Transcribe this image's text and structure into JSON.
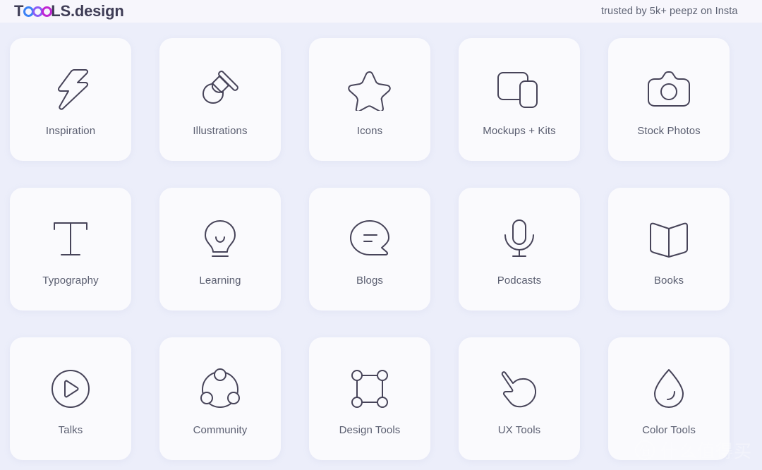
{
  "header": {
    "logo": {
      "prefix": "T",
      "suffix": "LS.design",
      "ring_colors": [
        "#3b82f6",
        "#8b5cf6",
        "#c026d3"
      ]
    },
    "tagline": "trusted by 5k+ peepz on Insta"
  },
  "theme": {
    "page_background": "#eceefa",
    "header_background": "#f7f6fc",
    "card_background": "#fafafd",
    "icon_stroke": "#474459",
    "label_color": "#5a5e70"
  },
  "grid": {
    "cards": [
      {
        "label": "Inspiration",
        "icon": "lightning-bolt-icon"
      },
      {
        "label": "Illustrations",
        "icon": "paintbrush-icon"
      },
      {
        "label": "Icons",
        "icon": "star-icon"
      },
      {
        "label": "Mockups + Kits",
        "icon": "devices-icon"
      },
      {
        "label": "Stock Photos",
        "icon": "camera-icon"
      },
      {
        "label": "Typography",
        "icon": "letter-t-icon"
      },
      {
        "label": "Learning",
        "icon": "lightbulb-icon"
      },
      {
        "label": "Blogs",
        "icon": "speech-bubble-icon"
      },
      {
        "label": "Podcasts",
        "icon": "microphone-icon"
      },
      {
        "label": "Books",
        "icon": "open-book-icon"
      },
      {
        "label": "Talks",
        "icon": "play-circle-icon"
      },
      {
        "label": "Community",
        "icon": "share-nodes-icon"
      },
      {
        "label": "Design Tools",
        "icon": "square-handles-icon"
      },
      {
        "label": "UX Tools",
        "icon": "cursor-hand-icon"
      },
      {
        "label": "Color Tools",
        "icon": "water-droplet-icon"
      }
    ]
  },
  "watermark": {
    "badge": "值",
    "text": "什么值得买"
  }
}
